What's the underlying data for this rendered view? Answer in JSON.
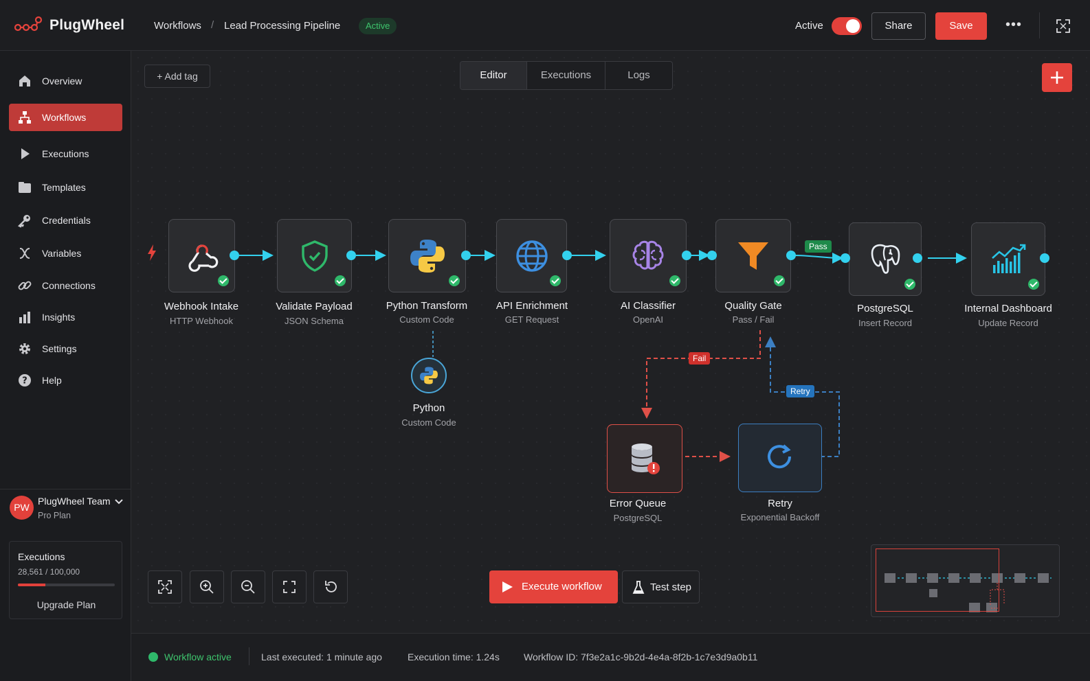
{
  "app": {
    "name": "PlugWheel"
  },
  "breadcrumb": {
    "section": "Workflows",
    "separator": "/",
    "workflow": "Lead Processing Pipeline",
    "status": "Active"
  },
  "header": {
    "active_label": "Active",
    "active_toggle_on": true,
    "share_label": "Share",
    "save_label": "Save",
    "more_label": "•••"
  },
  "sidebar": {
    "items": [
      {
        "label": "Overview",
        "icon": "home-icon"
      },
      {
        "label": "Workflows",
        "icon": "workflows-icon",
        "active": true
      },
      {
        "label": "Executions",
        "icon": "play-icon"
      },
      {
        "label": "Templates",
        "icon": "templates-icon"
      },
      {
        "label": "Credentials",
        "icon": "key-icon"
      },
      {
        "label": "Variables",
        "icon": "variable-icon"
      },
      {
        "label": "Connections",
        "icon": "link-icon"
      },
      {
        "label": "Insights",
        "icon": "chart-icon"
      },
      {
        "label": "Settings",
        "icon": "gear-icon"
      },
      {
        "label": "Help",
        "icon": "help-icon"
      }
    ],
    "team": {
      "avatar": "PW",
      "name": "PlugWheel Team",
      "plan": "Pro Plan"
    },
    "executions": {
      "title": "Executions",
      "count": "28,561 / 100,000",
      "used_fraction": 0.2856,
      "upgrade_label": "Upgrade Plan"
    }
  },
  "canvas": {
    "add_tag_label": "+ Add tag",
    "tabs": [
      {
        "label": "Editor",
        "active": true
      },
      {
        "label": "Executions"
      },
      {
        "label": "Logs"
      }
    ],
    "nodes": [
      {
        "title": "Webhook Intake",
        "subtitle": "HTTP Webhook",
        "icon": "webhook-icon"
      },
      {
        "title": "Validate Payload",
        "subtitle": "JSON Schema",
        "icon": "shield-icon"
      },
      {
        "title": "Python Transform",
        "subtitle": "Custom Code",
        "icon": "python-icon"
      },
      {
        "title": "API Enrichment",
        "subtitle": "GET Request",
        "icon": "globe-icon"
      },
      {
        "title": "AI Classifier",
        "subtitle": "OpenAI",
        "icon": "brain-icon"
      },
      {
        "title": "Quality Gate",
        "subtitle": "Pass / Fail",
        "icon": "funnel-icon"
      },
      {
        "title": "PostgreSQL",
        "subtitle": "Insert Record",
        "icon": "postgres-icon"
      },
      {
        "title": "Internal Dashboard",
        "subtitle": "Update Record",
        "icon": "dashboard-chart-icon"
      }
    ],
    "sub_node": {
      "title": "Python",
      "subtitle": "Custom Code",
      "icon": "python-icon"
    },
    "error_node": {
      "title": "Error Queue",
      "subtitle": "PostgreSQL",
      "icon": "database-error-icon"
    },
    "retry_node": {
      "title": "Retry",
      "subtitle": "Exponential Backoff",
      "icon": "refresh-icon"
    },
    "edge_labels": {
      "pass": "Pass",
      "fail": "Fail",
      "retry": "Retry"
    },
    "execute_label": "Execute workflow",
    "test_label": "Test step"
  },
  "status": {
    "active": "Workflow active",
    "last_executed": "Last executed: 1 minute ago",
    "execution_time": "Execution time: 1.24s",
    "workflow_id": "Workflow ID: 7f3e2a1c-9b2d-4e4a-8f2b-1c7e3d9a0b11"
  },
  "colors": {
    "accent": "#e4433c",
    "connector": "#33d1ee",
    "success": "#2fb86a",
    "fail": "#e05048",
    "retry": "#3c7fc2"
  }
}
